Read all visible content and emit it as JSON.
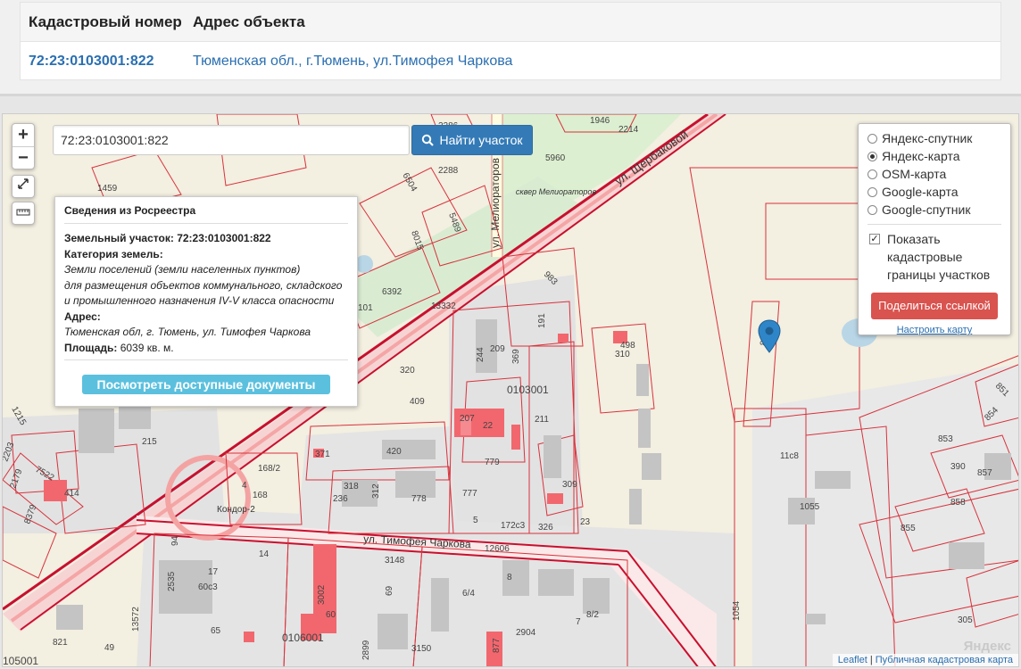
{
  "top": {
    "col_cadastral": "Кадастровый номер",
    "col_address": "Адрес объекта",
    "cadastral_number": "72:23:0103001:822",
    "address": "Тюменская обл., г.Тюмень, ул.Тимофея Чаркова"
  },
  "search": {
    "value": "72:23:0103001:822",
    "button_label": "Найти участок"
  },
  "controls": {
    "zoom_in": "+",
    "zoom_out": "−"
  },
  "rosreestr": {
    "title": "Сведения из Росреестра",
    "parcel_label": "Земельный участок:",
    "parcel_value": "72:23:0103001:822",
    "category_label": "Категория земель:",
    "category_value": "Земли поселений (земли населенных пунктов)",
    "category_desc_1": "для размещения объектов коммунального, складского",
    "category_desc_2": "и промышленного назначения IV-V класса опасности",
    "address_label": "Адрес:",
    "address_value": "Тюменская обл, г. Тюмень, ул. Тимофея Чаркова",
    "area_label": "Площадь:",
    "area_value": "6039 кв. м.",
    "docs_button": "Посмотреть доступные документы"
  },
  "layers": {
    "options": [
      "Яндекс-спутник",
      "Яндекс-карта",
      "OSM-карта",
      "Google-карта",
      "Google-спутник"
    ],
    "selected": "Яндекс-карта",
    "show_borders_1": "Показать",
    "show_borders_2": "кадастровые",
    "show_borders_3": "границы участков",
    "show_borders_checked": true,
    "share_button": "Поделиться ссылкой",
    "setup_link": "Настроить карту"
  },
  "map_labels": {
    "street_melioratorov": "ул. Мелиораторов",
    "street_chervishevsky": "ул. Щербаковой",
    "street_timofeya": "ул. Тимофея Чаркова",
    "square": "сквер Мелиораторов",
    "kondor": "Кондор-2",
    "block_0103001": "0103001",
    "block_0106001": "0106001",
    "block_105001": "105001",
    "numbers": [
      "2286",
      "1946",
      "2214",
      "5960",
      "2288",
      "6504",
      "1459",
      "5489",
      "8015",
      "6392",
      "101",
      "13332",
      "983",
      "191",
      "209",
      "244",
      "369",
      "310",
      "498",
      "320",
      "409",
      "207",
      "22",
      "211",
      "215",
      "371",
      "420",
      "779",
      "168/2",
      "168",
      "4",
      "318",
      "236",
      "312",
      "778",
      "777",
      "309",
      "23",
      "5",
      "172с3",
      "326",
      "12606",
      "94",
      "14",
      "17",
      "60с3",
      "3148",
      "8",
      "69",
      "6/4",
      "3002",
      "60",
      "65",
      "7",
      "8/2",
      "2904",
      "3150",
      "877",
      "821",
      "49",
      "1054",
      "1055",
      "11с8",
      "853",
      "390",
      "857",
      "858",
      "855",
      "854",
      "851",
      "305",
      "822",
      "2899",
      "2535",
      "13572",
      "414",
      "7522",
      "8379",
      "1215",
      "2203",
      "2179"
    ]
  },
  "attribution": {
    "leaflet": "Leaflet",
    "sep": " | ",
    "public_map": "Публичная кадастровая карта",
    "watermark": "Яндекс"
  }
}
